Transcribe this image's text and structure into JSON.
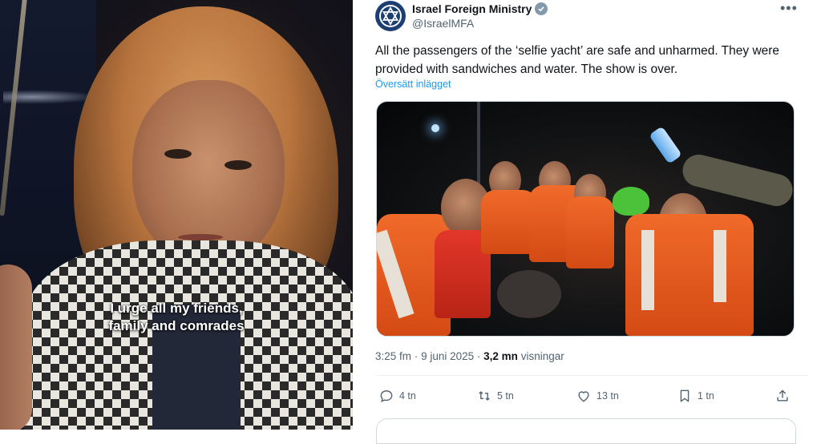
{
  "video": {
    "caption_line1": "I urge all my friends,",
    "caption_line2": "family and comrades"
  },
  "tweet": {
    "account": {
      "display_name": "Israel Foreign Ministry",
      "handle": "@IsraelMFA",
      "verified": true,
      "avatar_icon": "star-of-david-logo-icon",
      "avatar_color": "#1b3f73"
    },
    "text": "All the passengers of the ‘selfie yacht’ are safe and unharmed. They were provided with sandwiches and water. The show is over.",
    "translate_label": "Översätt inlägget",
    "meta": {
      "time": "3:25 fm",
      "separator": "·",
      "date": "9 juni 2025",
      "views_count": "3,2 mn",
      "views_label": "visningar"
    },
    "actions": {
      "replies": "4 tn",
      "reposts": "5 tn",
      "likes": "13 tn",
      "bookmarks": "1 tn"
    }
  },
  "colors": {
    "link": "#1d9bf0",
    "text_primary": "#0f1419",
    "text_secondary": "#536471",
    "verified_badge": "#829aab",
    "vest_orange": "#f06a2a"
  }
}
